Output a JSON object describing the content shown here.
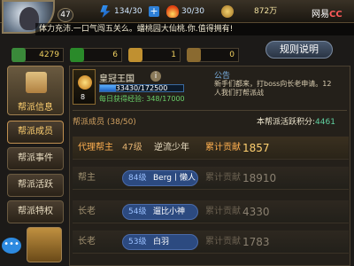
{
  "player": {
    "level": "47"
  },
  "stats": {
    "stamina": "134/30",
    "energy": "30/30",
    "coins": "872万"
  },
  "brand": "网易",
  "brand_suffix": "CC",
  "marquee": "体力充沛.一口气闯五关么。蟠桃园大仙桃.你.值得拥有!",
  "resources": {
    "r1": "4279",
    "r2": "6",
    "r3": "1",
    "r4": "0"
  },
  "rules_button": "规则说明",
  "nav": {
    "active": "帮派信息",
    "items": [
      "帮派成员",
      "帮派事件",
      "帮派活跃",
      "帮派特权"
    ]
  },
  "guild": {
    "name": "皇冠王国",
    "level": "8",
    "exp_text": "33430/172500",
    "exp_progress": 0.194,
    "daily_exp": "每日获得经验: 348/17000"
  },
  "notice": {
    "title": "公告",
    "text": "新手们都来，打boss向长老申请。12人我们打帮派战"
  },
  "members_label": "帮派成员 (38/50)",
  "activity": {
    "label": "本帮派活跃积分:",
    "value": "4461"
  },
  "members": [
    {
      "role": "代理帮主",
      "level": "47级",
      "name": "逆流少年",
      "contrib_label": "累计贡献",
      "contrib": "1857"
    },
    {
      "role": "帮主",
      "level": "84级",
      "name": "Berg丨懒人",
      "contrib_label": "累计贡献",
      "contrib": "18910"
    },
    {
      "role": "长老",
      "level": "54级",
      "name": "遛比小神",
      "contrib_label": "累计贡献",
      "contrib": "4330"
    },
    {
      "role": "长老",
      "level": "53级",
      "name": "白羽",
      "contrib_label": "累计贡献",
      "contrib": "1783"
    }
  ],
  "icons": {
    "stamina": "lightning-icon",
    "energy": "fire-icon",
    "coins": "coin-icon",
    "info": "info-icon",
    "chat": "chat-bubble-icon"
  }
}
